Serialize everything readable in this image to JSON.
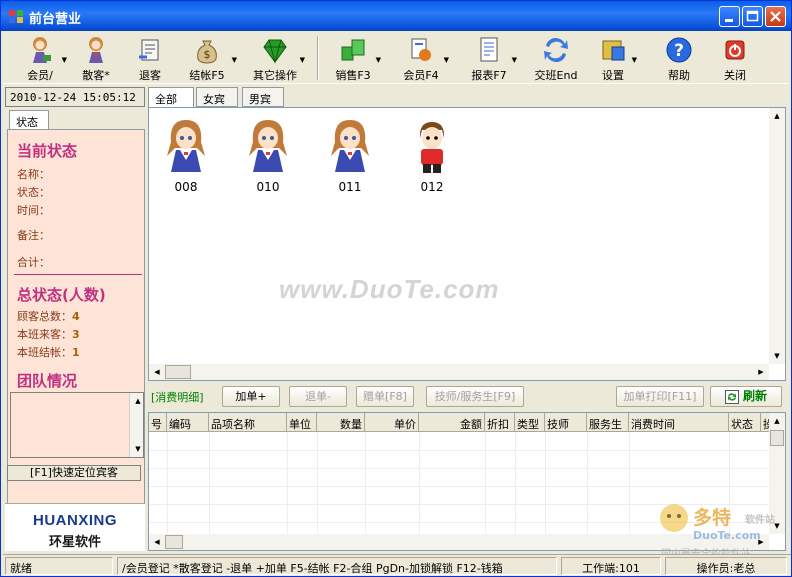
{
  "window": {
    "title": "前台营业"
  },
  "toolbar": {
    "items": [
      {
        "label": "会员/",
        "icon": "member-girl-icon"
      },
      {
        "label": "散客*",
        "icon": "guest-girl-icon"
      },
      {
        "label": "退客",
        "icon": "checkout-guest-icon"
      },
      {
        "label": "结帐F5",
        "icon": "money-bag-icon"
      },
      {
        "label": "其它操作",
        "icon": "diamond-icon"
      },
      {
        "label": "销售F3",
        "icon": "sales-cubes-icon"
      },
      {
        "label": "会员F4",
        "icon": "member-card-icon"
      },
      {
        "label": "报表F7",
        "icon": "report-icon"
      },
      {
        "label": "交班End",
        "icon": "shift-change-icon"
      },
      {
        "label": "设置",
        "icon": "settings-icon"
      },
      {
        "label": "帮助",
        "icon": "help-icon"
      },
      {
        "label": "关闭",
        "icon": "power-icon"
      }
    ]
  },
  "left": {
    "datetime": "2010-12-24 15:05:12",
    "tab": "状态",
    "current_status": {
      "title": "当前状态",
      "name_label": "名称：",
      "state_label": "状态：",
      "time_label": "时间：",
      "note_label": "备注：",
      "total_label": "合计："
    },
    "overall": {
      "title": "总状态(人数)",
      "total_guests_label": "顾客总数：",
      "total_guests": "4",
      "shift_arrivals_label": "本班来客：",
      "shift_arrivals": "3",
      "shift_checkouts_label": "本班结帐：",
      "shift_checkouts": "1"
    },
    "team_title": "团队情况",
    "quick_locate": "[F1]快速定位宾客",
    "logo_en": "HUANXING",
    "logo_cn": "环星软件"
  },
  "main": {
    "tabs": [
      "全部",
      "女宾",
      "男宾"
    ],
    "rooms": [
      {
        "number": "008",
        "icon": "female-guest-icon"
      },
      {
        "number": "010",
        "icon": "female-guest-icon"
      },
      {
        "number": "011",
        "icon": "female-guest-icon"
      },
      {
        "number": "012",
        "icon": "male-guest-icon"
      }
    ],
    "watermark": "www.DuoTe.com"
  },
  "bill": {
    "label": "[消费明细]",
    "buttons": {
      "add": "加单+",
      "refund": "退单-",
      "gift": "赠单[F8]",
      "staff": "技师/服务生[F9]",
      "print": "加单打印[F11]",
      "refresh": "刷新"
    },
    "columns": [
      "号",
      "编码",
      "品项名称",
      "单位",
      "数量",
      "单价",
      "金额",
      "折扣",
      "类型",
      "技师",
      "服务生",
      "消费时间",
      "状态",
      "操"
    ]
  },
  "statusbar": {
    "ready": "就绪",
    "hints": "/会员登记 *散客登记 -退单 +加单 F5-结帐 F2-合组 PgDn-加锁解锁 F12-钱箱",
    "terminal": "工作端:101",
    "operator": "操作员:老总"
  },
  "corner_watermark": {
    "big": "多特",
    "small": "软件站",
    "url": "DuoTe.com",
    "footer": "国内最安全的软件站"
  }
}
